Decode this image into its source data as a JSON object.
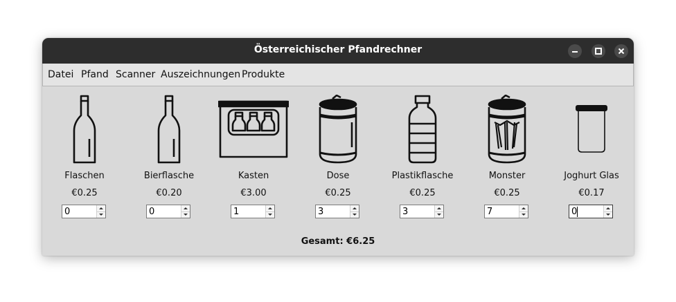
{
  "window": {
    "title": "Österreichischer Pfandrechner"
  },
  "menu": [
    "Datei",
    "Pfand",
    "Scanner",
    "Auszeichnungen",
    "Produkte"
  ],
  "items": [
    {
      "name": "Flaschen",
      "price": "€0.25",
      "qty": "0",
      "icon": "wine-bottle-icon"
    },
    {
      "name": "Bierflasche",
      "price": "€0.20",
      "qty": "0",
      "icon": "beer-bottle-icon"
    },
    {
      "name": "Kasten",
      "price": "€3.00",
      "qty": "1",
      "icon": "crate-icon"
    },
    {
      "name": "Dose",
      "price": "€0.25",
      "qty": "3",
      "icon": "can-icon"
    },
    {
      "name": "Plastikflasche",
      "price": "€0.25",
      "qty": "3",
      "icon": "plastic-bottle-icon"
    },
    {
      "name": "Monster",
      "price": "€0.25",
      "qty": "7",
      "icon": "monster-can-icon"
    },
    {
      "name": "Joghurt Glas",
      "price": "€0.17",
      "qty": "0",
      "icon": "jar-icon"
    }
  ],
  "total": "Gesamt: €6.25"
}
